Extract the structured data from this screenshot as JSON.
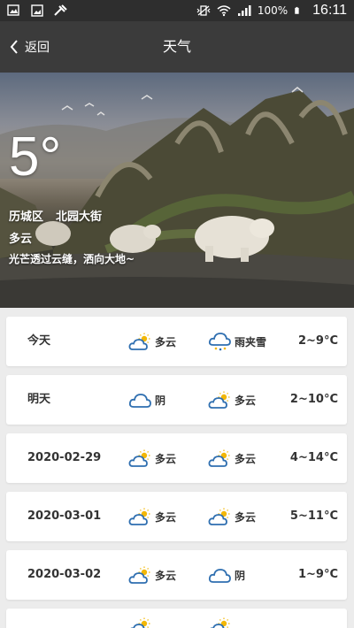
{
  "status_bar": {
    "battery": "100%",
    "time": "16:11"
  },
  "app_bar": {
    "back_label": "返回",
    "title": "天气"
  },
  "current": {
    "temperature": "5°",
    "district": "历城区",
    "street": "北园大街",
    "condition": "多云",
    "slogan": "光芒透过云缝，洒向大地~"
  },
  "forecast": [
    {
      "date": "今天",
      "day_cond": "多云",
      "day_icon": "partly-cloudy",
      "night_cond": "雨夹雪",
      "night_icon": "sleet",
      "temp": "2~9°C"
    },
    {
      "date": "明天",
      "day_cond": "阴",
      "day_icon": "cloudy",
      "night_cond": "多云",
      "night_icon": "partly-cloudy",
      "temp": "2~10°C"
    },
    {
      "date": "2020-02-29",
      "day_cond": "多云",
      "day_icon": "partly-cloudy",
      "night_cond": "多云",
      "night_icon": "partly-cloudy",
      "temp": "4~14°C"
    },
    {
      "date": "2020-03-01",
      "day_cond": "多云",
      "day_icon": "partly-cloudy",
      "night_cond": "多云",
      "night_icon": "partly-cloudy",
      "temp": "5~11°C"
    },
    {
      "date": "2020-03-02",
      "day_cond": "多云",
      "day_icon": "partly-cloudy",
      "night_cond": "阴",
      "night_icon": "cloudy",
      "temp": "1~9°C"
    },
    {
      "date": "",
      "day_cond": "",
      "day_icon": "partly-cloudy",
      "night_cond": "",
      "night_icon": "partly-cloudy",
      "temp": ""
    }
  ],
  "colors": {
    "status_bar": "#2e2e2e",
    "app_bar": "#3b3b3b",
    "icon_blue": "#2f6fb0",
    "sun_yellow": "#f2b705",
    "list_bg": "#ececec"
  }
}
